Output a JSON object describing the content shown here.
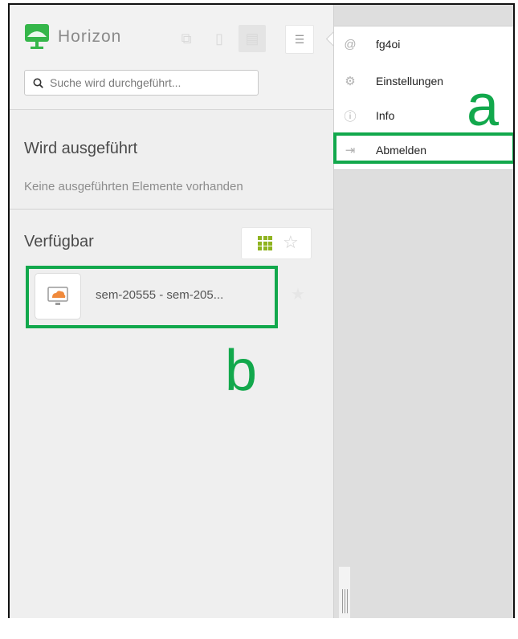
{
  "app": {
    "brand": "Horizon"
  },
  "toolbar": {
    "buttons": [
      {
        "icon": "network-icon"
      },
      {
        "icon": "documents-icon"
      },
      {
        "icon": "clipboard-icon"
      },
      {
        "icon": "menu-list-icon"
      }
    ]
  },
  "search": {
    "placeholder": "Suche wird durchgeführt..."
  },
  "running": {
    "title": "Wird ausgeführt",
    "empty": "Keine ausgeführten Elemente vorhanden"
  },
  "available": {
    "title": "Verfügbar",
    "items": [
      {
        "name": "sem-20555 - sem-205..."
      }
    ]
  },
  "user_menu": {
    "items": [
      {
        "label": "fg4oi",
        "icon": "user-icon"
      },
      {
        "label": "Einstellungen",
        "icon": "gear-icon"
      },
      {
        "label": "Info",
        "icon": "info-icon"
      },
      {
        "label": "Abmelden",
        "icon": "logout-icon"
      }
    ]
  },
  "annotations": {
    "a": "a",
    "b": "b"
  },
  "colors": {
    "highlight": "#12a84c",
    "grid_accent": "#8fb320",
    "logo_green": "#35b64a"
  }
}
